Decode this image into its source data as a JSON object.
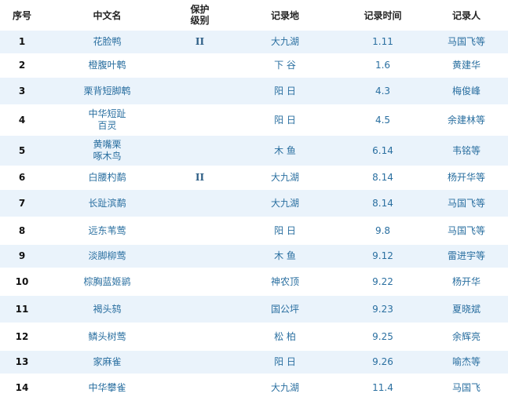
{
  "headers": {
    "no": "序号",
    "name": "中文名",
    "level_line1": "保护",
    "level_line2": "级别",
    "location": "记录地",
    "time": "记录时间",
    "recorder": "记录人"
  },
  "rows": [
    {
      "no": "1",
      "name": [
        "花脸鸭"
      ],
      "level": "II",
      "location": "大九湖",
      "time": "1.11",
      "recorder": "马国飞等"
    },
    {
      "no": "2",
      "name": [
        "橙腹叶鹎"
      ],
      "level": "",
      "location": "下  谷",
      "time": "1.6",
      "recorder": "黄建华"
    },
    {
      "no": "3",
      "name": [
        "栗背短脚鹎"
      ],
      "level": "",
      "location": "阳  日",
      "time": "4.3",
      "recorder": "梅俊峰"
    },
    {
      "no": "4",
      "name": [
        "中华短趾",
        "百灵"
      ],
      "level": "",
      "location": "阳  日",
      "time": "4.5",
      "recorder": "余建林等"
    },
    {
      "no": "5",
      "name": [
        "黄嘴栗",
        "啄木鸟"
      ],
      "level": "",
      "location": "木  鱼",
      "time": "6.14",
      "recorder": "韦铭等"
    },
    {
      "no": "6",
      "name": [
        "白腰杓鹬"
      ],
      "level": "II",
      "location": "大九湖",
      "time": "8.14",
      "recorder": "杨开华等"
    },
    {
      "no": "7",
      "name": [
        "长趾滨鹬"
      ],
      "level": "",
      "location": "大九湖",
      "time": "8.14",
      "recorder": "马国飞等"
    },
    {
      "no": "8",
      "name": [
        "远东苇莺"
      ],
      "level": "",
      "location": "阳  日",
      "time": "9.8",
      "recorder": "马国飞等"
    },
    {
      "no": "9",
      "name": [
        "淡脚柳莺"
      ],
      "level": "",
      "location": "木  鱼",
      "time": "9.12",
      "recorder": "雷进宇等"
    },
    {
      "no": "10",
      "name": [
        "棕胸蓝姬鹟"
      ],
      "level": "",
      "location": "神农顶",
      "time": "9.22",
      "recorder": "杨开华"
    },
    {
      "no": "11",
      "name": [
        "褐头鸫"
      ],
      "level": "",
      "location": "国公坪",
      "time": "9.23",
      "recorder": "夏晓斌"
    },
    {
      "no": "12",
      "name": [
        "鳞头树莺"
      ],
      "level": "",
      "location": "松  柏",
      "time": "9.25",
      "recorder": "余辉亮"
    },
    {
      "no": "13",
      "name": [
        "家麻雀"
      ],
      "level": "",
      "location": "阳  日",
      "time": "9.26",
      "recorder": "喻杰等"
    },
    {
      "no": "14",
      "name": [
        "中华攀雀"
      ],
      "level": "",
      "location": "大九湖",
      "time": "11.4",
      "recorder": "马国飞"
    }
  ]
}
